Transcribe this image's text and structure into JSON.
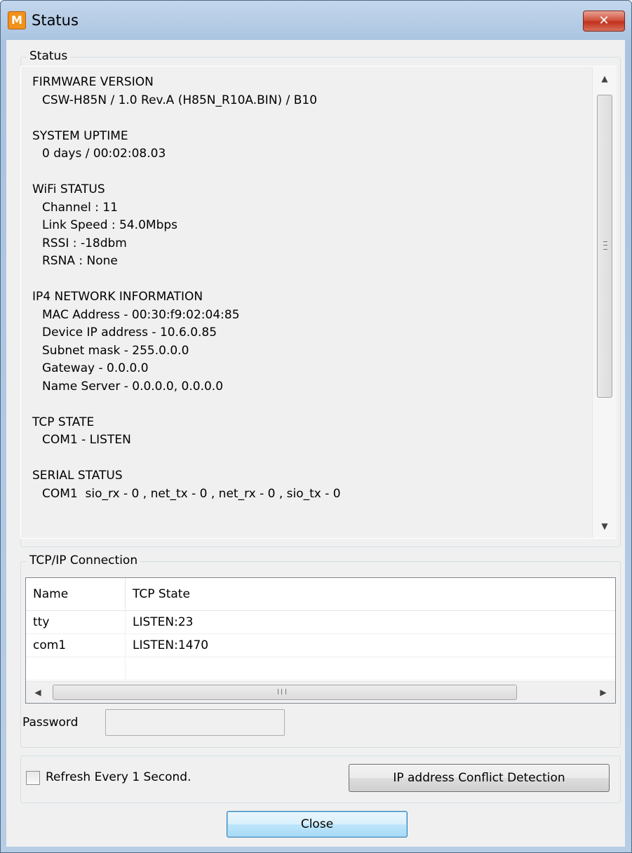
{
  "window": {
    "title": "Status",
    "app_icon_letter": "M",
    "close_glyph": "✕"
  },
  "status_group": {
    "legend": "Status",
    "sections": [
      {
        "heading": "FIRMWARE VERSION",
        "lines": [
          "CSW-H85N / 1.0 Rev.A (H85N_R10A.BIN) / B10"
        ]
      },
      {
        "heading": "SYSTEM UPTIME",
        "lines": [
          "0 days / 00:02:08.03"
        ]
      },
      {
        "heading": "WiFi STATUS",
        "lines": [
          "Channel : 11",
          "Link Speed : 54.0Mbps",
          "RSSI : -18dbm",
          "RSNA : None"
        ]
      },
      {
        "heading": "IP4 NETWORK INFORMATION",
        "lines": [
          "MAC Address - 00:30:f9:02:04:85",
          "Device IP address - 10.6.0.85",
          "Subnet mask - 255.0.0.0",
          "Gateway - 0.0.0.0",
          "Name Server - 0.0.0.0, 0.0.0.0"
        ]
      },
      {
        "heading": "TCP STATE",
        "lines": [
          "COM1 - LISTEN"
        ]
      },
      {
        "heading": "SERIAL STATUS",
        "lines": [
          "COM1  sio_rx - 0 , net_tx - 0 , net_rx - 0 , sio_tx - 0"
        ]
      }
    ]
  },
  "tcp_group": {
    "legend": "TCP/IP Connection",
    "columns": [
      "Name",
      "TCP State"
    ],
    "rows": [
      {
        "name": "tty",
        "state": "LISTEN:23"
      },
      {
        "name": "com1",
        "state": "LISTEN:1470"
      }
    ],
    "password_label": "Password",
    "password_value": ""
  },
  "options": {
    "refresh_label": "Refresh Every 1 Second.",
    "refresh_checked": false,
    "ip_conflict_button": "IP address Conflict Detection"
  },
  "footer": {
    "close_button": "Close"
  },
  "colors": {
    "title_gradient": "#b7cde6",
    "client_bg": "#f0f0f0",
    "close_red": "#c0311c",
    "default_button_blue": "#bee6fd"
  }
}
